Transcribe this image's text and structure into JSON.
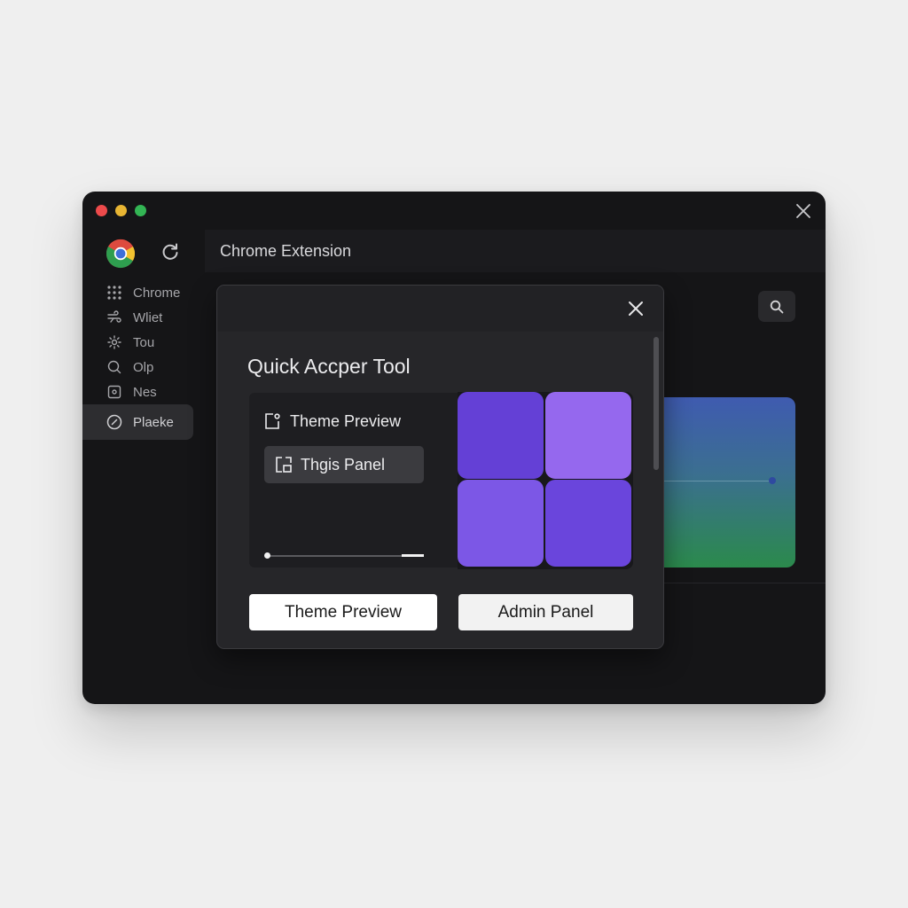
{
  "sidebar": {
    "items": [
      {
        "label": "Chrome",
        "icon": "grid-icon"
      },
      {
        "label": "Wliet",
        "icon": "wind-icon"
      },
      {
        "label": "Tou",
        "icon": "settings-icon"
      },
      {
        "label": "Olp",
        "icon": "bubble-icon"
      },
      {
        "label": "Nes",
        "icon": "square-icon"
      },
      {
        "label": "Plaeke",
        "icon": "compass-icon",
        "active": true
      }
    ]
  },
  "header": {
    "title": "Chrome Extension"
  },
  "dialog": {
    "title": "Quick Accper Tool",
    "options": [
      {
        "label": "Theme Preview",
        "icon": "frame-icon"
      },
      {
        "label": "Thgis Panel",
        "icon": "panel-icon",
        "selected": true
      }
    ],
    "slider": {
      "value": 0.0
    },
    "buttons": {
      "theme_preview": "Theme Preview",
      "admin_panel": "Admin Panel"
    }
  },
  "colors": {
    "window_bg": "#151517",
    "dialog_bg": "#262629",
    "accent_purple": "#6440d6",
    "accent_light_purple": "#9568ee",
    "traffic_red": "#ed4a4b",
    "traffic_yellow": "#e8b533",
    "traffic_green": "#33b554"
  }
}
